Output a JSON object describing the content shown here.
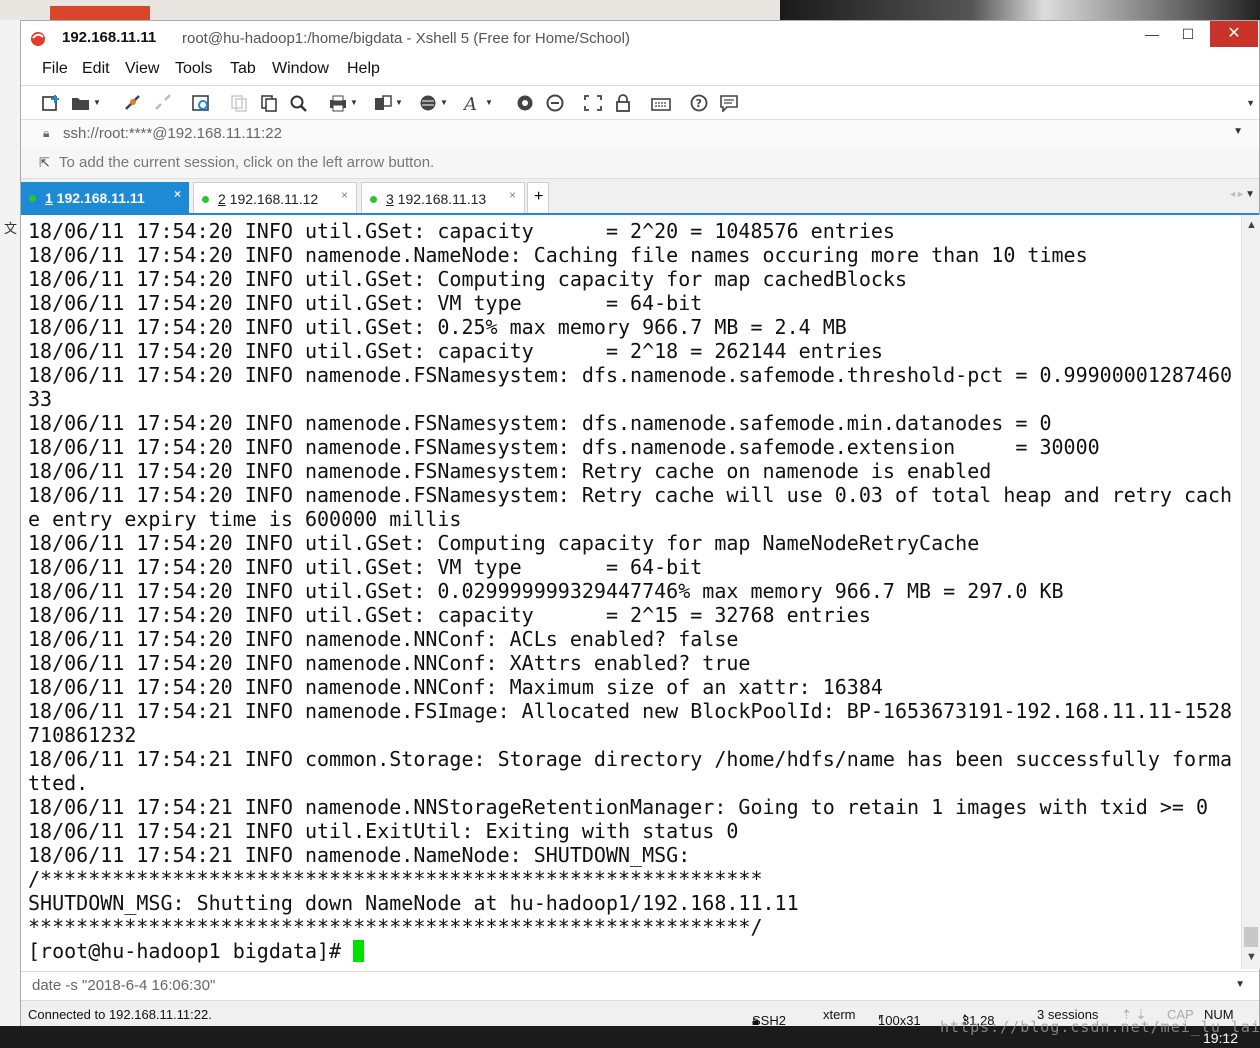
{
  "window": {
    "title_ip": "192.168.11.11",
    "title_rest": "root@hu-hadoop1:/home/bigdata - Xshell 5 (Free for Home/School)",
    "min_label": "—",
    "max_label": "☐",
    "close_label": "✕"
  },
  "menu": [
    "File",
    "Edit",
    "View",
    "Tools",
    "Tab",
    "Window",
    "Help"
  ],
  "address": {
    "value": "ssh://root:****@192.168.11.11:22"
  },
  "hint": {
    "text": "To add the current session, click on the left arrow button."
  },
  "tabs": [
    {
      "num": "1",
      "label": " 192.168.11.11",
      "active": true
    },
    {
      "num": "2",
      "label": " 192.168.11.12",
      "active": false
    },
    {
      "num": "3",
      "label": " 192.168.11.13",
      "active": false
    }
  ],
  "tab_plus": "+",
  "tab_close": "×",
  "terminal": {
    "lines": [
      "18/06/11 17:54:20 INFO util.GSet: capacity      = 2^20 = 1048576 entries",
      "18/06/11 17:54:20 INFO namenode.NameNode: Caching file names occuring more than 10 times",
      "18/06/11 17:54:20 INFO util.GSet: Computing capacity for map cachedBlocks",
      "18/06/11 17:54:20 INFO util.GSet: VM type       = 64-bit",
      "18/06/11 17:54:20 INFO util.GSet: 0.25% max memory 966.7 MB = 2.4 MB",
      "18/06/11 17:54:20 INFO util.GSet: capacity      = 2^18 = 262144 entries",
      "18/06/11 17:54:20 INFO namenode.FSNamesystem: dfs.namenode.safemode.threshold-pct = 0.99900001287460",
      "33",
      "18/06/11 17:54:20 INFO namenode.FSNamesystem: dfs.namenode.safemode.min.datanodes = 0",
      "18/06/11 17:54:20 INFO namenode.FSNamesystem: dfs.namenode.safemode.extension     = 30000",
      "18/06/11 17:54:20 INFO namenode.FSNamesystem: Retry cache on namenode is enabled",
      "18/06/11 17:54:20 INFO namenode.FSNamesystem: Retry cache will use 0.03 of total heap and retry cach",
      "e entry expiry time is 600000 millis",
      "18/06/11 17:54:20 INFO util.GSet: Computing capacity for map NameNodeRetryCache",
      "18/06/11 17:54:20 INFO util.GSet: VM type       = 64-bit",
      "18/06/11 17:54:20 INFO util.GSet: 0.029999999329447746% max memory 966.7 MB = 297.0 KB",
      "18/06/11 17:54:20 INFO util.GSet: capacity      = 2^15 = 32768 entries",
      "18/06/11 17:54:20 INFO namenode.NNConf: ACLs enabled? false",
      "18/06/11 17:54:20 INFO namenode.NNConf: XAttrs enabled? true",
      "18/06/11 17:54:20 INFO namenode.NNConf: Maximum size of an xattr: 16384",
      "18/06/11 17:54:21 INFO namenode.FSImage: Allocated new BlockPoolId: BP-1653673191-192.168.11.11-1528",
      "710861232",
      "18/06/11 17:54:21 INFO common.Storage: Storage directory /home/hdfs/name has been successfully forma",
      "tted.",
      "18/06/11 17:54:21 INFO namenode.NNStorageRetentionManager: Going to retain 1 images with txid >= 0",
      "18/06/11 17:54:21 INFO util.ExitUtil: Exiting with status 0",
      "18/06/11 17:54:21 INFO namenode.NameNode: SHUTDOWN_MSG:",
      "/************************************************************",
      "SHUTDOWN_MSG: Shutting down NameNode at hu-hadoop1/192.168.11.11",
      "************************************************************/"
    ],
    "prompt": "[root@hu-hadoop1 bigdata]# "
  },
  "command_bar": {
    "value": "date -s \"2018-6-4 16:06:30\""
  },
  "status": {
    "connected": "Connected to 192.168.11.11:22.",
    "protocol": "SSH2",
    "term": "xterm",
    "size": "100x31",
    "cursor_pos": "31,28",
    "sessions": "3 sessions",
    "cap": "CAP",
    "num": "NUM"
  },
  "taskbar": {
    "clock": "19:12",
    "watermark": "https://blog.csdn.net/mei_lu_lai"
  },
  "colors": {
    "accent": "#1e8ad6",
    "close_button": "#c9342a",
    "cursor": "#00e000",
    "session_dot": "#2cc52c"
  }
}
